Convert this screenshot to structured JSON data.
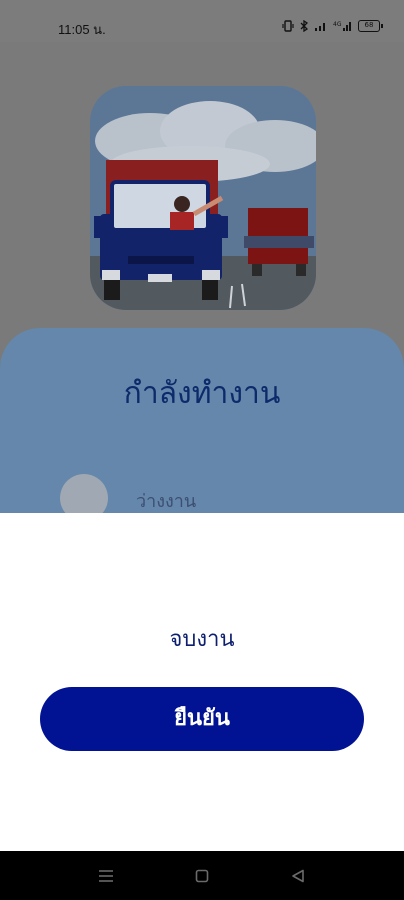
{
  "status_bar": {
    "time": "11:05 น.",
    "battery_level": "68"
  },
  "hero": {
    "illustration": "delivery-truck-driver-illustration"
  },
  "card": {
    "title": "กำลังทำงาน",
    "option_label": "ว่างงาน"
  },
  "sheet": {
    "message": "จบงาน",
    "confirm_label": "ยืนยัน"
  },
  "nav": {
    "menu_icon": "menu-icon",
    "home_icon": "home-icon",
    "back_icon": "back-icon"
  },
  "colors": {
    "primary": "#011292",
    "overlay_gray": "#7a7a7a",
    "card_blue": "#6487ab",
    "text_dark_blue": "#0d1f6e"
  }
}
